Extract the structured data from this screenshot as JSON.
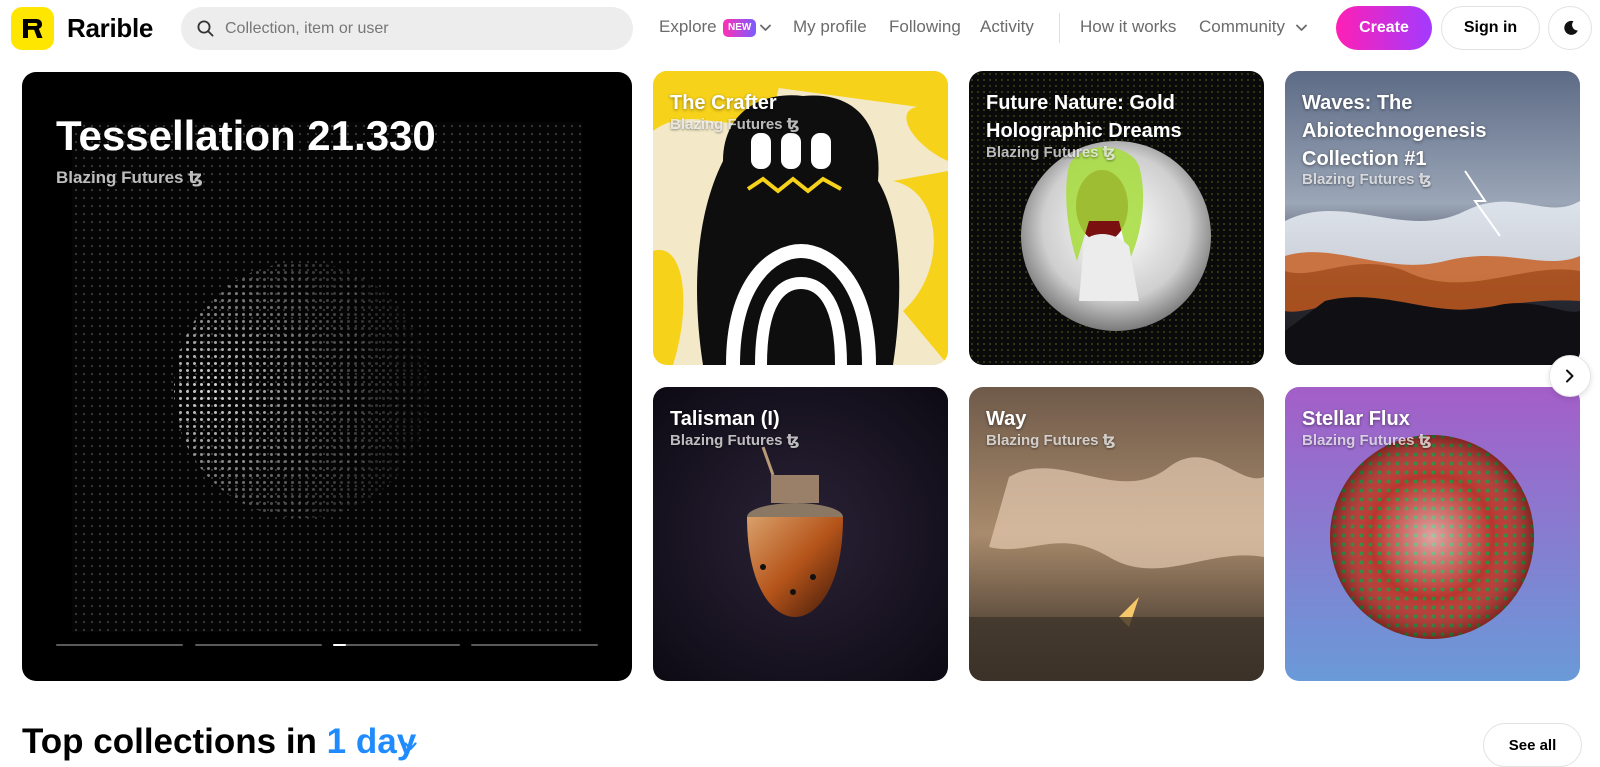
{
  "header": {
    "brand": "Rarible",
    "search": {
      "placeholder": "Collection, item or user",
      "value": ""
    },
    "nav": {
      "explore": "Explore",
      "explore_badge": "NEW",
      "my_profile": "My profile",
      "following": "Following",
      "activity": "Activity",
      "how_it_works": "How it works",
      "community": "Community"
    },
    "create_label": "Create",
    "signin_label": "Sign in",
    "theme_icon": "moon-icon"
  },
  "hero": {
    "title": "Tessellation 21.330",
    "collection": "Blazing Futures ꜩ",
    "slides": 4,
    "active_slide_progress": 0.1
  },
  "cards": [
    {
      "title": "The Crafter",
      "collection": "Blazing Futures ꜩ"
    },
    {
      "title": "Future Nature: Gold Holographic Dreams",
      "collection": "Blazing Futures ꜩ"
    },
    {
      "title": "Waves: The Abiotechnogenesis Collection #1",
      "collection": "Blazing Futures ꜩ"
    },
    {
      "title": "Talisman (I)",
      "collection": "Blazing Futures ꜩ"
    },
    {
      "title": "Way",
      "collection": "Blazing Futures ꜩ"
    },
    {
      "title": "Stellar Flux",
      "collection": "Blazing Futures ꜩ"
    }
  ],
  "carousel": {
    "next_icon": "chevron-right-icon"
  },
  "top_collections": {
    "title_prefix": "Top collections in",
    "period": "1 day",
    "see_all": "See all"
  },
  "colors": {
    "brand_yellow": "#ffe600",
    "create_gradient_start": "#ff1fb4",
    "create_gradient_end": "#a23bff",
    "accent_blue": "#1f8bff"
  }
}
